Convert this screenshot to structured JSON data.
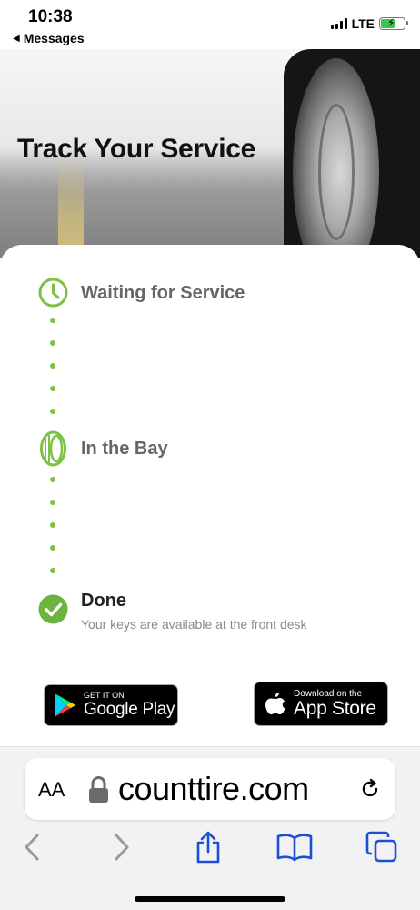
{
  "status_bar": {
    "time": "10:38",
    "back_label": "Messages",
    "carrier": "LTE"
  },
  "hero": {
    "title": "Track Your Service"
  },
  "steps": [
    {
      "label": "Waiting for Service",
      "icon": "clock-icon"
    },
    {
      "label": "In the Bay",
      "icon": "tire-icon"
    },
    {
      "label": "Done",
      "icon": "check-circle-icon",
      "subtitle": "Your keys are available at the front desk"
    }
  ],
  "stores": {
    "google": {
      "small": "GET IT ON",
      "big": "Google Play"
    },
    "apple": {
      "small": "Download on the",
      "big": "App Store"
    }
  },
  "browser": {
    "aa_label": "AA",
    "url": "counttire.com"
  },
  "colors": {
    "accent_green": "#7cc242",
    "check_green": "#6cb33f",
    "ios_blue": "#1a4fd6"
  }
}
